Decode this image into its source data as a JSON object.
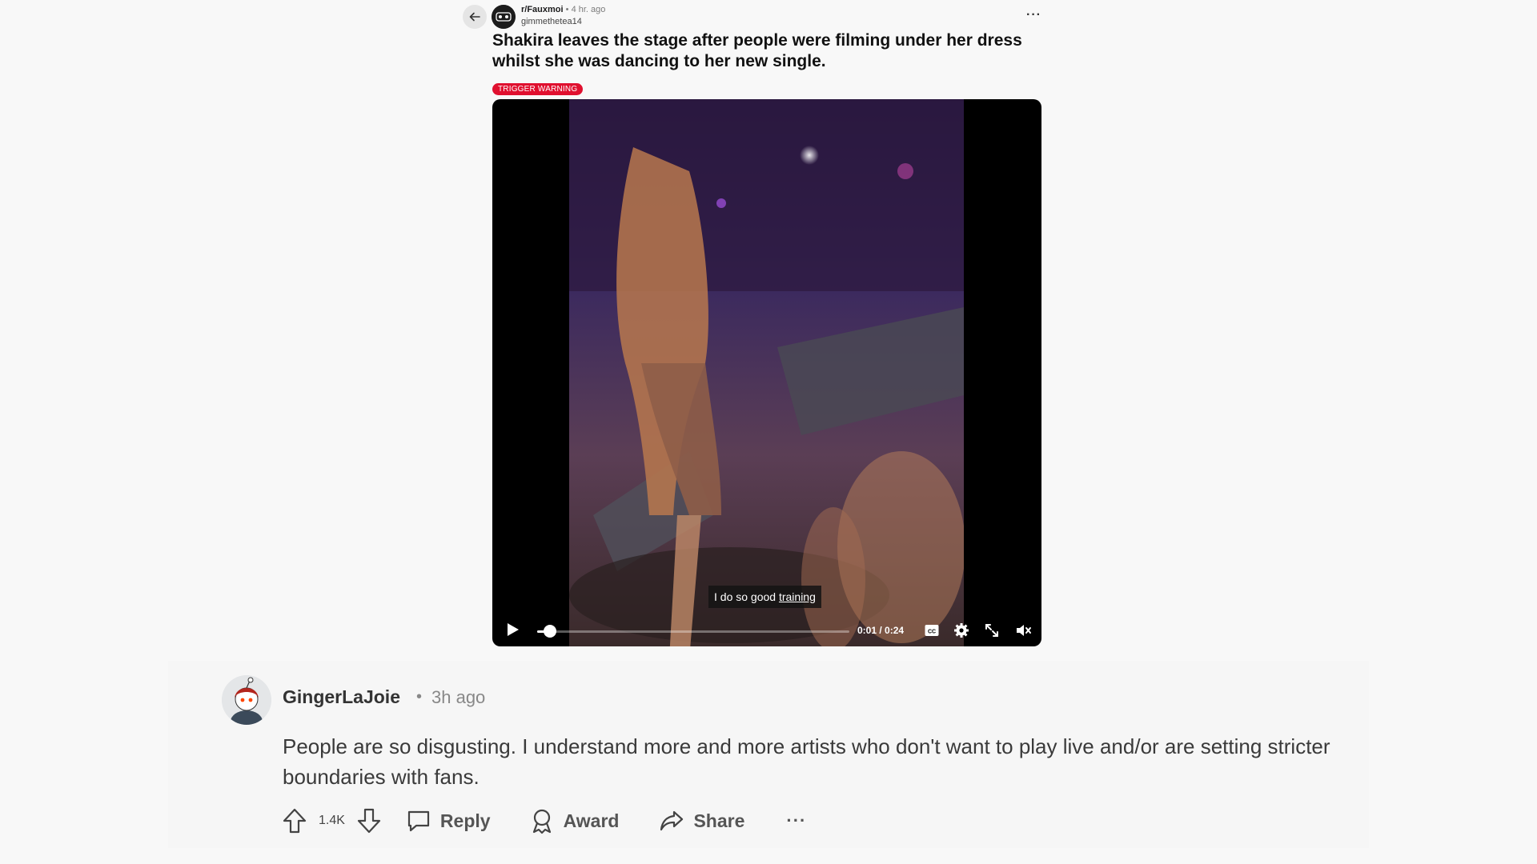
{
  "post": {
    "subreddit": "r/Fauxmoi",
    "separator": "•",
    "time": "4 hr. ago",
    "author": "gimmethetea14",
    "more": "···",
    "title": "Shakira leaves the stage after people were filming under her dress whilst she was dancing to her new single.",
    "flair": "TRIGGER WARNING"
  },
  "video": {
    "caption_pre": "I do so good ",
    "caption_link": "training",
    "time_readout": "0:01 / 0:24",
    "progress_fraction": 0.04,
    "cc_label": "CC"
  },
  "comment": {
    "username": "GingerLaJoie",
    "separator": "•",
    "time": "3h ago",
    "body": "People are so disgusting. I understand more and more artists who don't want to play live and/or are setting stricter boundaries with fans.",
    "score": "1.4K",
    "reply_label": "Reply",
    "award_label": "Award",
    "share_label": "Share",
    "more": "···"
  },
  "colors": {
    "flair": "#e0102f",
    "background": "#f8f8f8"
  }
}
